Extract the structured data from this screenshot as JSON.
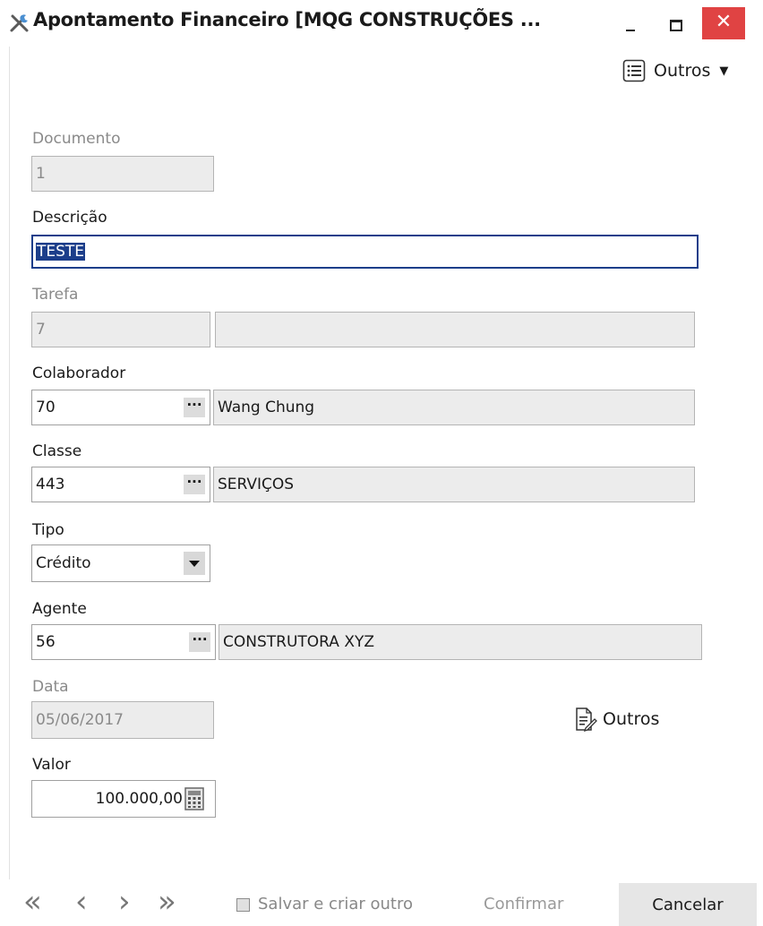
{
  "window": {
    "title": "Apontamento Financeiro [MQG CONSTRUÇÕES ...",
    "minimize_icon": "minimize-icon",
    "maximize_icon": "maximize-icon",
    "close_label": "✕",
    "close_color": "#e04343",
    "app_icon": "tools-icon"
  },
  "toolbar": {
    "outros_label": "Outros",
    "outros_icon": "list-icon"
  },
  "form": {
    "documento": {
      "label": "Documento",
      "value": "1"
    },
    "descricao": {
      "label": "Descrição",
      "value": "TESTE"
    },
    "tarefa": {
      "label": "Tarefa",
      "code": "7",
      "description": ""
    },
    "colaborador": {
      "label": "Colaborador",
      "code": "70",
      "name": "Wang Chung",
      "lookup_label": "···"
    },
    "classe": {
      "label": "Classe",
      "code": "443",
      "name": "SERVIÇOS",
      "lookup_label": "···"
    },
    "tipo": {
      "label": "Tipo",
      "value": "Crédito"
    },
    "agente": {
      "label": "Agente",
      "code": "56",
      "name": "CONSTRUTORA XYZ",
      "lookup_label": "···"
    },
    "data": {
      "label": "Data",
      "value": "05/06/2017"
    },
    "valor": {
      "label": "Valor",
      "value": "100.000,00"
    },
    "outros_link": "Outros"
  },
  "footer": {
    "nav_first": "«",
    "nav_prev": "‹",
    "nav_next": "›",
    "nav_last": "»",
    "save_and_new_label": "Salvar e criar outro",
    "confirm_label": "Confirmar",
    "cancel_label": "Cancelar"
  },
  "colors": {
    "selection": "#1c3e8a",
    "close_button": "#e04343"
  }
}
